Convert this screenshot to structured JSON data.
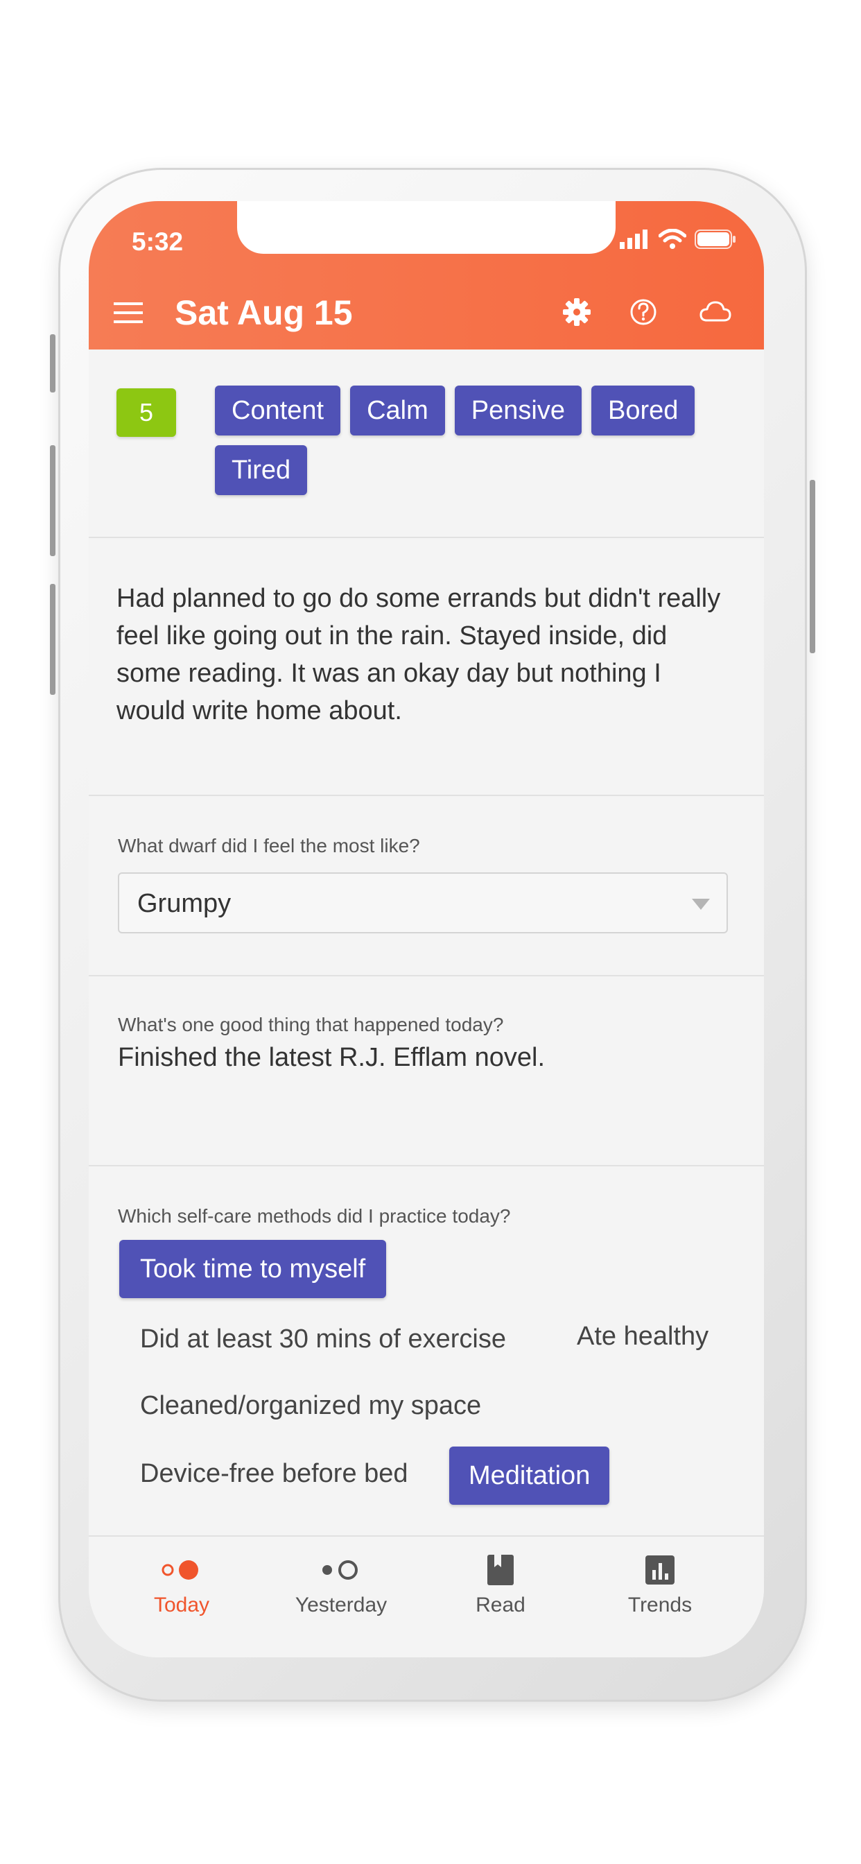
{
  "status_bar": {
    "time": "5:32"
  },
  "header": {
    "title": "Sat Aug 15",
    "menu_icon": "hamburger-menu-icon",
    "icons": [
      "gear-icon",
      "help-circle-icon",
      "cloud-icon"
    ]
  },
  "mood": {
    "score": "5",
    "score_color": "#8dc712",
    "tags": [
      "Content",
      "Calm",
      "Pensive",
      "Bored",
      "Tired"
    ],
    "tag_color": "#5052b6"
  },
  "journal": {
    "text": "Had planned to go do some errands but didn't really feel like going out in the rain. Stayed inside, did some reading. It was an okay day but nothing I would write home about."
  },
  "dwarf_question": {
    "label": "What dwarf did I feel the most like?",
    "selected": "Grumpy"
  },
  "good_thing_question": {
    "label": "What's one good thing that happened today?",
    "answer": "Finished the latest R.J. Efflam novel."
  },
  "self_care": {
    "label": "Which self-care methods did I practice today?",
    "options": [
      {
        "label": "Took time to myself",
        "selected": true
      },
      {
        "label": "Did at least 30 mins of exercise",
        "selected": false
      },
      {
        "label": "Ate healthy",
        "selected": false
      },
      {
        "label": "Cleaned/organized my space",
        "selected": false
      },
      {
        "label": "Device-free before bed",
        "selected": false
      },
      {
        "label": "Meditation",
        "selected": true
      }
    ]
  },
  "tabs": [
    {
      "label": "Today",
      "icon": "today-dots-icon",
      "active": true
    },
    {
      "label": "Yesterday",
      "icon": "yesterday-dots-icon",
      "active": false
    },
    {
      "label": "Read",
      "icon": "book-icon",
      "active": false
    },
    {
      "label": "Trends",
      "icon": "bar-chart-icon",
      "active": false
    }
  ],
  "colors": {
    "header_accent": "#f6693f",
    "tab_active": "#f0552c"
  }
}
